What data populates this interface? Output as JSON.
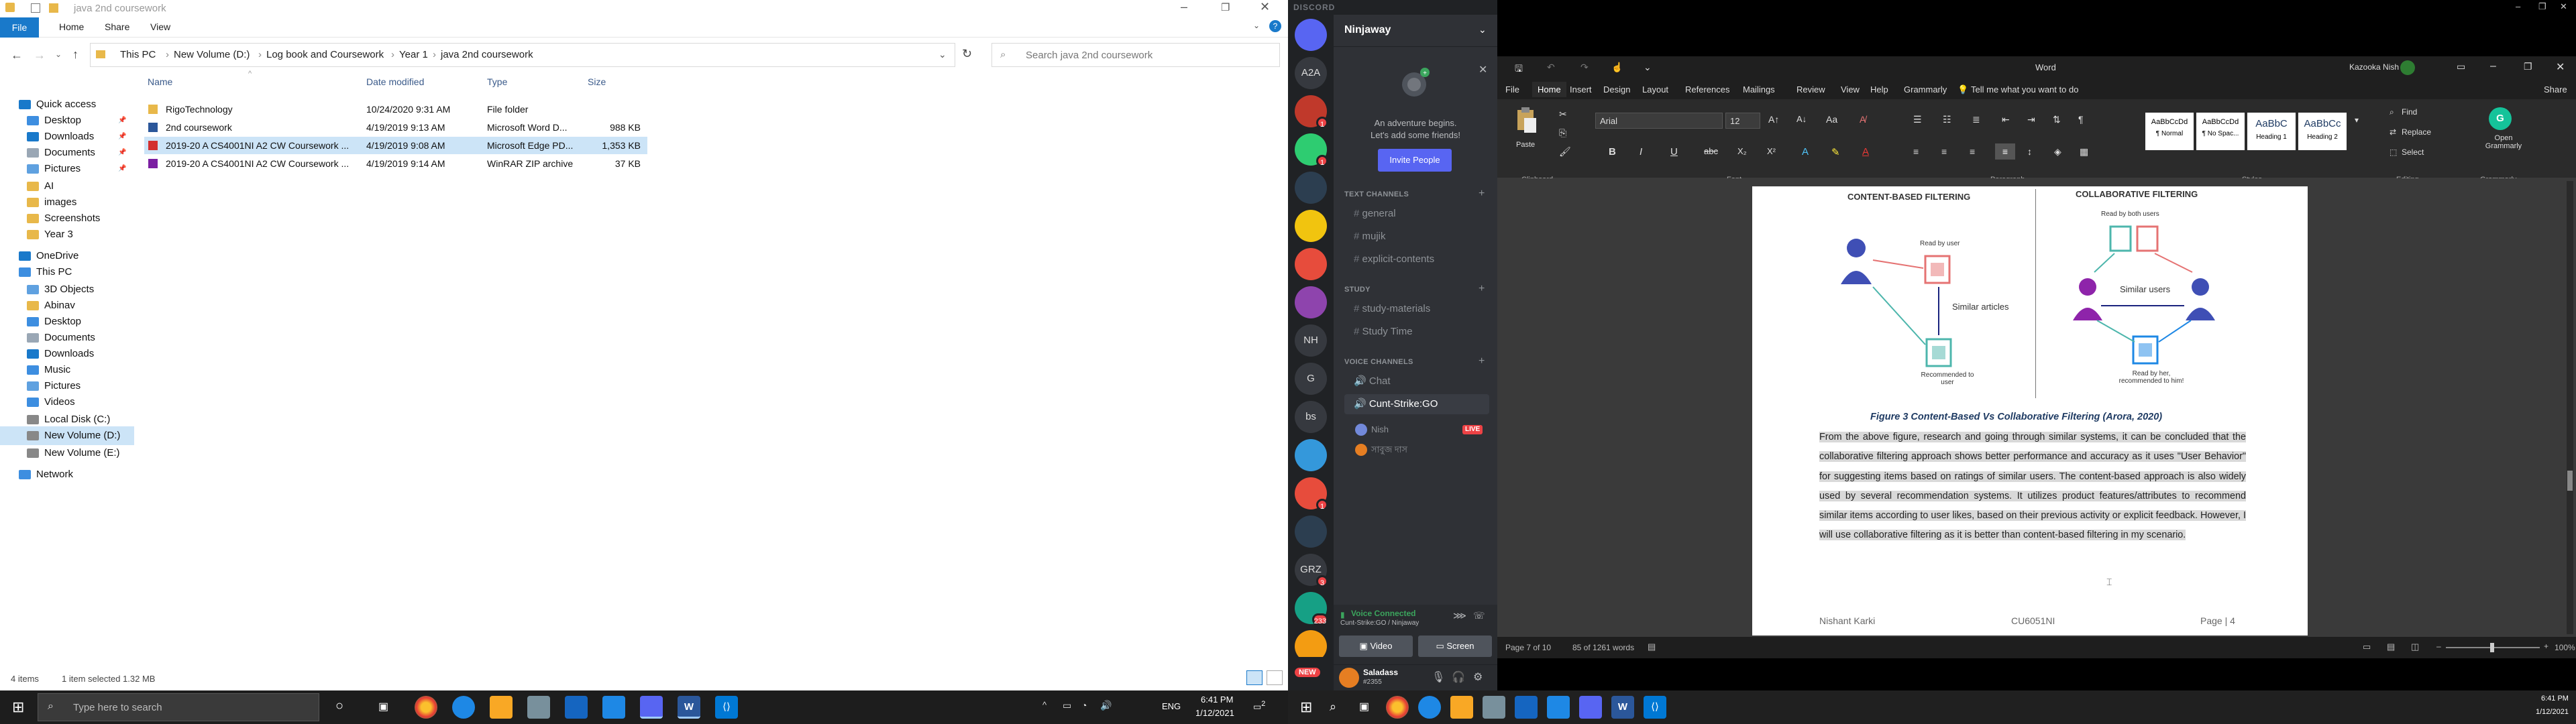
{
  "explorer": {
    "title": "java 2nd coursework",
    "ribbon": {
      "file": "File",
      "home": "Home",
      "share": "Share",
      "view": "View"
    },
    "breadcrumb": [
      "This PC",
      "New Volume (D:)",
      "Log book and Coursework",
      "Year 1",
      "java 2nd coursework"
    ],
    "search_placeholder": "Search java 2nd coursework",
    "nav": [
      {
        "label": "Quick access",
        "icon": "star-icon"
      },
      {
        "label": "Desktop",
        "icon": "desktop-icon",
        "pinned": true
      },
      {
        "label": "Downloads",
        "icon": "download-icon",
        "pinned": true
      },
      {
        "label": "Documents",
        "icon": "documents-icon",
        "pinned": true
      },
      {
        "label": "Pictures",
        "icon": "pictures-icon",
        "pinned": true
      },
      {
        "label": "AI",
        "icon": "folder-icon"
      },
      {
        "label": "images",
        "icon": "folder-icon"
      },
      {
        "label": "Screenshots",
        "icon": "folder-icon"
      },
      {
        "label": "Year 3",
        "icon": "folder-icon"
      },
      {
        "label": "OneDrive",
        "icon": "cloud-icon"
      },
      {
        "label": "This PC",
        "icon": "computer-icon"
      },
      {
        "label": "3D Objects",
        "icon": "cube-icon"
      },
      {
        "label": "Abinav",
        "icon": "folder-icon"
      },
      {
        "label": "Desktop",
        "icon": "desktop-icon"
      },
      {
        "label": "Documents",
        "icon": "documents-icon"
      },
      {
        "label": "Downloads",
        "icon": "download-icon"
      },
      {
        "label": "Music",
        "icon": "music-icon"
      },
      {
        "label": "Pictures",
        "icon": "pictures-icon"
      },
      {
        "label": "Videos",
        "icon": "video-icon"
      },
      {
        "label": "Local Disk (C:)",
        "icon": "drive-icon"
      },
      {
        "label": "New Volume (D:)",
        "icon": "drive-icon",
        "selected": true
      },
      {
        "label": "New Volume (E:)",
        "icon": "drive-icon"
      },
      {
        "label": "Network",
        "icon": "network-icon"
      }
    ],
    "columns": {
      "name": "Name",
      "date": "Date modified",
      "type": "Type",
      "size": "Size"
    },
    "files": [
      {
        "name": "RigoTechnology",
        "date": "10/24/2020 9:31 AM",
        "type": "File folder",
        "size": "",
        "icon": "folder-icon"
      },
      {
        "name": "2nd coursework",
        "date": "4/19/2019 9:13 AM",
        "type": "Microsoft Word D...",
        "size": "988 KB",
        "icon": "word-icon"
      },
      {
        "name": "2019-20 A CS4001NI A2 CW Coursework ...",
        "date": "4/19/2019 9:08 AM",
        "type": "Microsoft Edge PD...",
        "size": "1,353 KB",
        "icon": "pdf-icon",
        "selected": true
      },
      {
        "name": "2019-20 A CS4001NI A2 CW Coursework ...",
        "date": "4/19/2019 9:14 AM",
        "type": "WinRAR ZIP archive",
        "size": "37 KB",
        "icon": "zip-icon"
      }
    ],
    "status_items": "4 items",
    "status_selected": "1 item selected  1.32 MB"
  },
  "discord": {
    "app": "DISCORD",
    "server_name": "Ninjaway",
    "banner_line1": "An adventure begins.",
    "banner_line2": "Let's add some friends!",
    "invite_label": "Invite People",
    "servers": [
      {
        "label": "",
        "icon": "discord-icon"
      },
      {
        "label": "A2A"
      },
      {
        "label": "",
        "badge": "1"
      },
      {
        "label": "",
        "badge": "1"
      },
      {
        "label": ""
      },
      {
        "label": ""
      },
      {
        "label": ""
      },
      {
        "label": ""
      },
      {
        "label": "NH"
      },
      {
        "label": "G"
      },
      {
        "label": "bs"
      },
      {
        "label": ""
      },
      {
        "label": "",
        "badge": "1"
      },
      {
        "label": ""
      },
      {
        "label": "GRZ",
        "badge": "3"
      },
      {
        "label": "",
        "badge": "233"
      },
      {
        "label": ""
      }
    ],
    "categories": [
      {
        "name": "TEXT CHANNELS",
        "channels": [
          "general",
          "mujik",
          "explicit-contents"
        ]
      },
      {
        "name": "STUDY",
        "channels": [
          "study-materials",
          "Study Time"
        ]
      },
      {
        "name": "VOICE CHANNELS",
        "channels": [
          "Chat",
          "Cunt-Strike:GO"
        ]
      }
    ],
    "voice_users": [
      {
        "name": "Nish",
        "live": "LIVE"
      },
      {
        "name": "সাবুজ দাস"
      }
    ],
    "voice_status": "Voice Connected",
    "voice_channel": "Cunt-Strike:GO / Ninjaway",
    "video_label": "Video",
    "screen_label": "Screen",
    "username": "Saladass",
    "tag": "#2355",
    "new_badge": "NEW"
  },
  "word": {
    "title": "Word",
    "user": "Kazooka Nish",
    "tabs": [
      "File",
      "Home",
      "Insert",
      "Design",
      "Layout",
      "References",
      "Mailings",
      "Review",
      "View",
      "Help",
      "Grammarly"
    ],
    "tell_me": "Tell me what you want to do",
    "share": "Share",
    "font": "Arial",
    "font_size": "12",
    "groups": [
      "Clipboard",
      "Font",
      "Paragraph",
      "Styles",
      "Editing",
      "Grammarly"
    ],
    "paste": "Paste",
    "styles": [
      {
        "sample": "AaBbCcDd",
        "name": "¶ Normal"
      },
      {
        "sample": "AaBbCcDd",
        "name": "¶ No Spac..."
      },
      {
        "sample": "AaBbC",
        "name": "Heading 1"
      },
      {
        "sample": "AaBbCc",
        "name": "Heading 2"
      }
    ],
    "editing": [
      "Find",
      "Replace",
      "Select"
    ],
    "grammarly_btn": "Open Grammarly",
    "fig_left": "CONTENT-BASED FILTERING",
    "fig_right": "COLLABORATIVE FILTERING",
    "fig_read_by_user": "Read by user",
    "fig_similar_articles": "Similar articles",
    "fig_recommended": "Recommended to user",
    "fig_read_both": "Read by both users",
    "fig_similar_users": "Similar users",
    "fig_read_by_her": "Read by her, recommended to him!",
    "caption": "Figure 3 Content-Based Vs Collaborative Filtering (Arora, 2020)",
    "paragraph": "From the above figure, research and going through similar systems, it can be concluded that the collaborative filtering approach shows better performance and accuracy as it uses \"User Behavior\" for suggesting items based on ratings of similar users. The content-based approach is also widely used by several recommendation systems. It utilizes product features/attributes to recommend similar items according to user likes, based on their previous activity or explicit feedback. However, I will use collaborative filtering as it is better than content-based filtering in my scenario.",
    "footer_name": "Nishant Karki",
    "footer_code": "CU6051NI",
    "footer_page": "Page | 4",
    "status_page": "Page 7 of 10",
    "status_words": "85 of 1261 words",
    "zoom": "100%"
  },
  "taskbar": {
    "search_placeholder": "Type here to search",
    "lang": "ENG",
    "time": "6:41 PM",
    "date": "1/12/2021",
    "time2": "6:41 PM",
    "date2": "1/12/2021",
    "notif": "2"
  }
}
